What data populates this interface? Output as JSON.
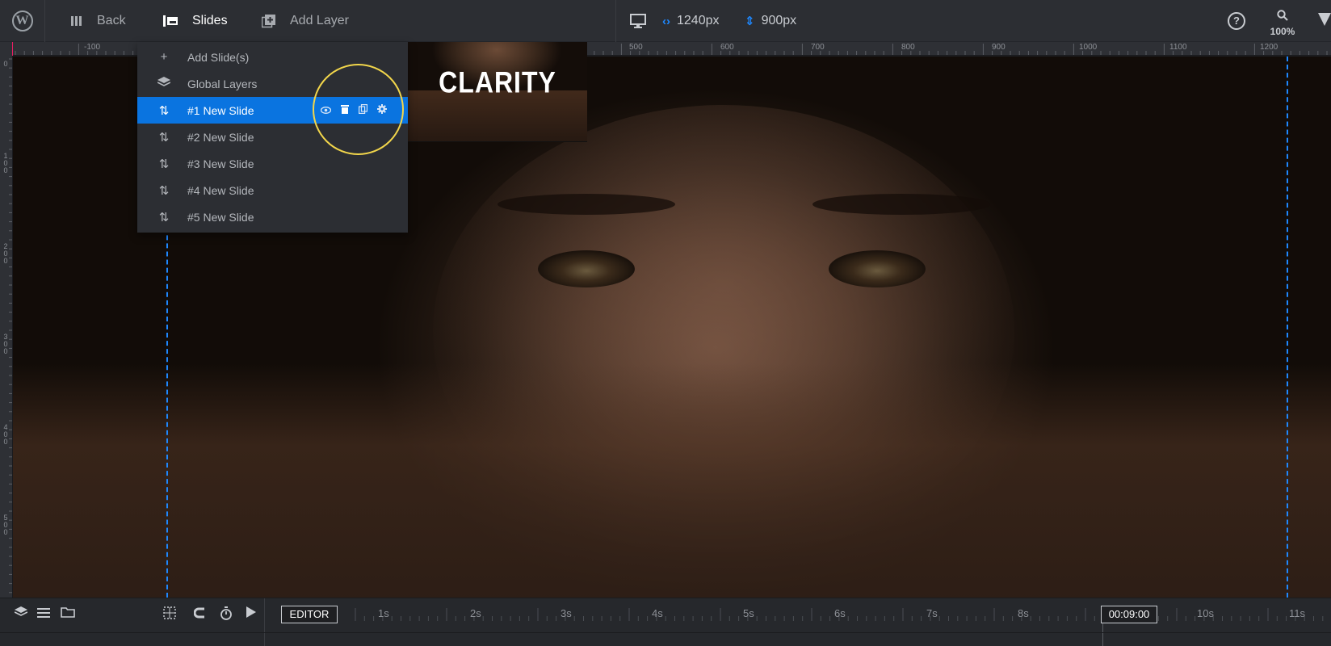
{
  "topbar": {
    "back_label": "Back",
    "slides_label": "Slides",
    "add_layer_label": "Add Layer",
    "width_value": "1240px",
    "height_value": "900px",
    "help_glyph": "?",
    "zoom_value": "100%",
    "wp_glyph": "W",
    "accent_color": "#1e88ff"
  },
  "ruler": {
    "h_labels": [
      "-100",
      "500",
      "600",
      "700",
      "800",
      "900",
      "1000",
      "1100",
      "1200"
    ],
    "v_labels": [
      "0",
      "100",
      "200",
      "300",
      "400",
      "500"
    ]
  },
  "slides_menu": {
    "items": [
      {
        "label": "Add Slide(s)",
        "icon": "plus-icon"
      },
      {
        "label": "Global Layers",
        "icon": "layers-icon"
      },
      {
        "label": "#1 New Slide",
        "icon": "sort-icon",
        "selected": true
      },
      {
        "label": "#2 New Slide",
        "icon": "sort-icon"
      },
      {
        "label": "#3 New Slide",
        "icon": "sort-icon"
      },
      {
        "label": "#4 New Slide",
        "icon": "sort-icon"
      },
      {
        "label": "#5 New Slide",
        "icon": "sort-icon"
      }
    ],
    "selected_color": "#0a74e0",
    "actions": [
      "eye-icon",
      "trash-icon",
      "duplicate-icon",
      "gear-icon"
    ],
    "highlight_color": "#f2d64b"
  },
  "preview": {
    "title": "CLARITY"
  },
  "timeline": {
    "editor_label": "EDITOR",
    "time_labels": [
      "1s",
      "2s",
      "3s",
      "4s",
      "5s",
      "6s",
      "7s",
      "8s",
      "10s",
      "11s"
    ],
    "current_time": "00:09:00"
  }
}
